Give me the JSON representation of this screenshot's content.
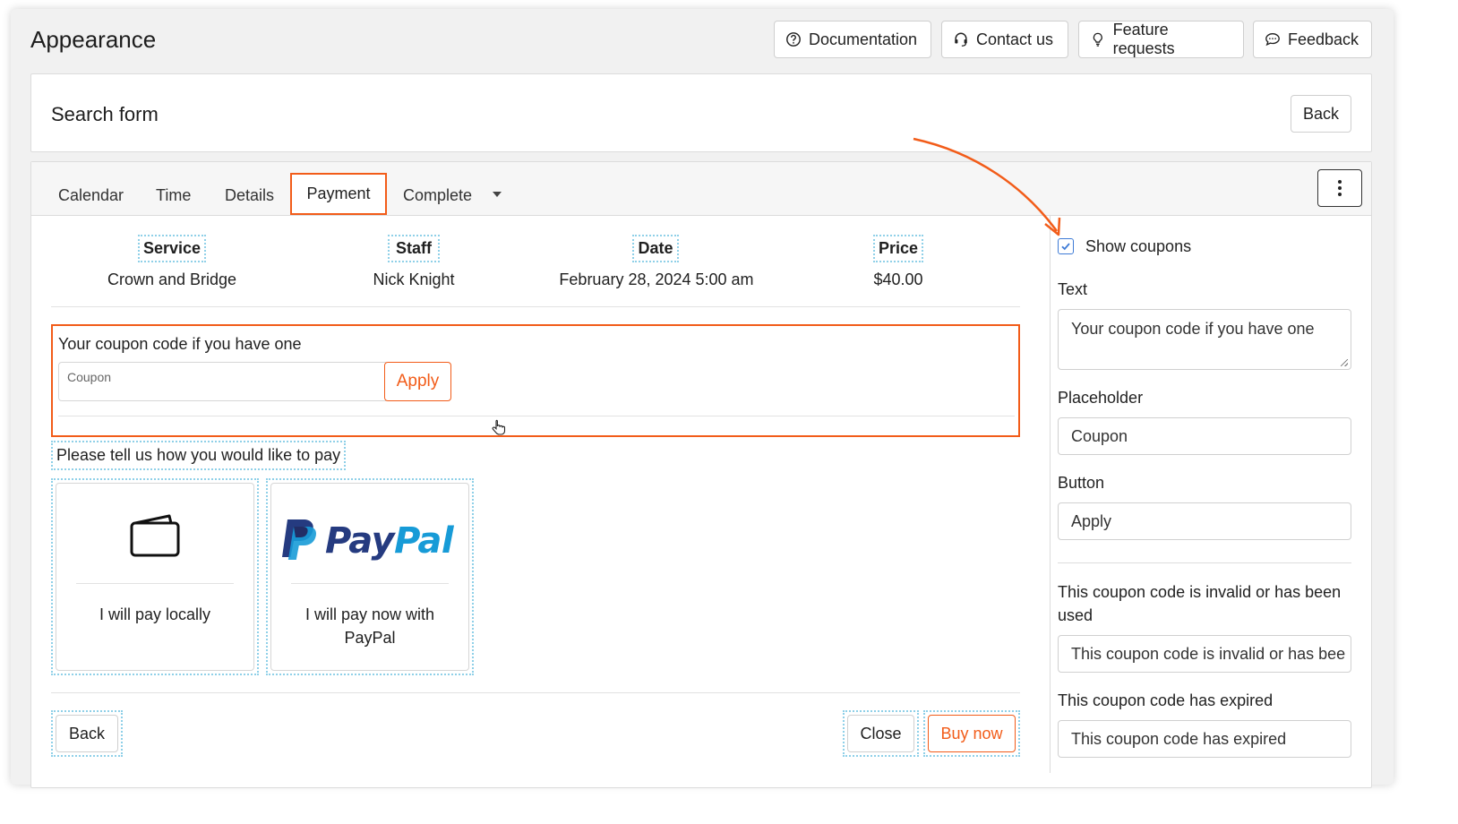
{
  "page": {
    "title": "Appearance"
  },
  "top_buttons": {
    "documentation": "Documentation",
    "contact": "Contact us",
    "feature": "Feature requests",
    "feedback": "Feedback"
  },
  "search_form": {
    "title": "Search form",
    "back": "Back"
  },
  "tabs": {
    "calendar": "Calendar",
    "time": "Time",
    "details": "Details",
    "payment": "Payment",
    "complete": "Complete"
  },
  "summary": [
    {
      "head": "Service",
      "value": "Crown and Bridge"
    },
    {
      "head": "Staff",
      "value": "Nick Knight"
    },
    {
      "head": "Date",
      "value": "February 28, 2024 5:00 am"
    },
    {
      "head": "Price",
      "value": "$40.00"
    }
  ],
  "coupon": {
    "label": "Your coupon code if you have one",
    "placeholder": "Coupon",
    "button": "Apply"
  },
  "payment": {
    "title": "Please tell us how you would like to pay",
    "local_label": "I will pay locally",
    "paypal_logo": "PayPal",
    "paypal_label_line1": "I will pay now with",
    "paypal_label_line2": "PayPal"
  },
  "footer": {
    "back": "Back",
    "close": "Close",
    "buy": "Buy now"
  },
  "settings": {
    "show_coupons_label": "Show coupons",
    "show_coupons_checked": true,
    "text_label": "Text",
    "text_value": "Your coupon code if you have one",
    "placeholder_label": "Placeholder",
    "placeholder_value": "Coupon",
    "button_label": "Button",
    "button_value": "Apply",
    "invalid_label": "This coupon code is invalid or has been used",
    "invalid_value": "This coupon code is invalid or has bee",
    "expired_label": "This coupon code has expired",
    "expired_value": "This coupon code has expired"
  },
  "colors": {
    "accent": "#f25c19",
    "dotted_outline": "#8fd0e8",
    "checkbox": "#3e7bd6",
    "paypal_dark": "#253b80",
    "paypal_light": "#179bd7"
  },
  "icons": [
    "question-circle-icon",
    "headset-icon",
    "lightbulb-icon",
    "chat-bubble-icon",
    "kebab-menu-icon",
    "wallet-icon",
    "paypal-logo-icon",
    "checkmark-icon",
    "hand-cursor-icon",
    "arrow-annotation-icon"
  ]
}
